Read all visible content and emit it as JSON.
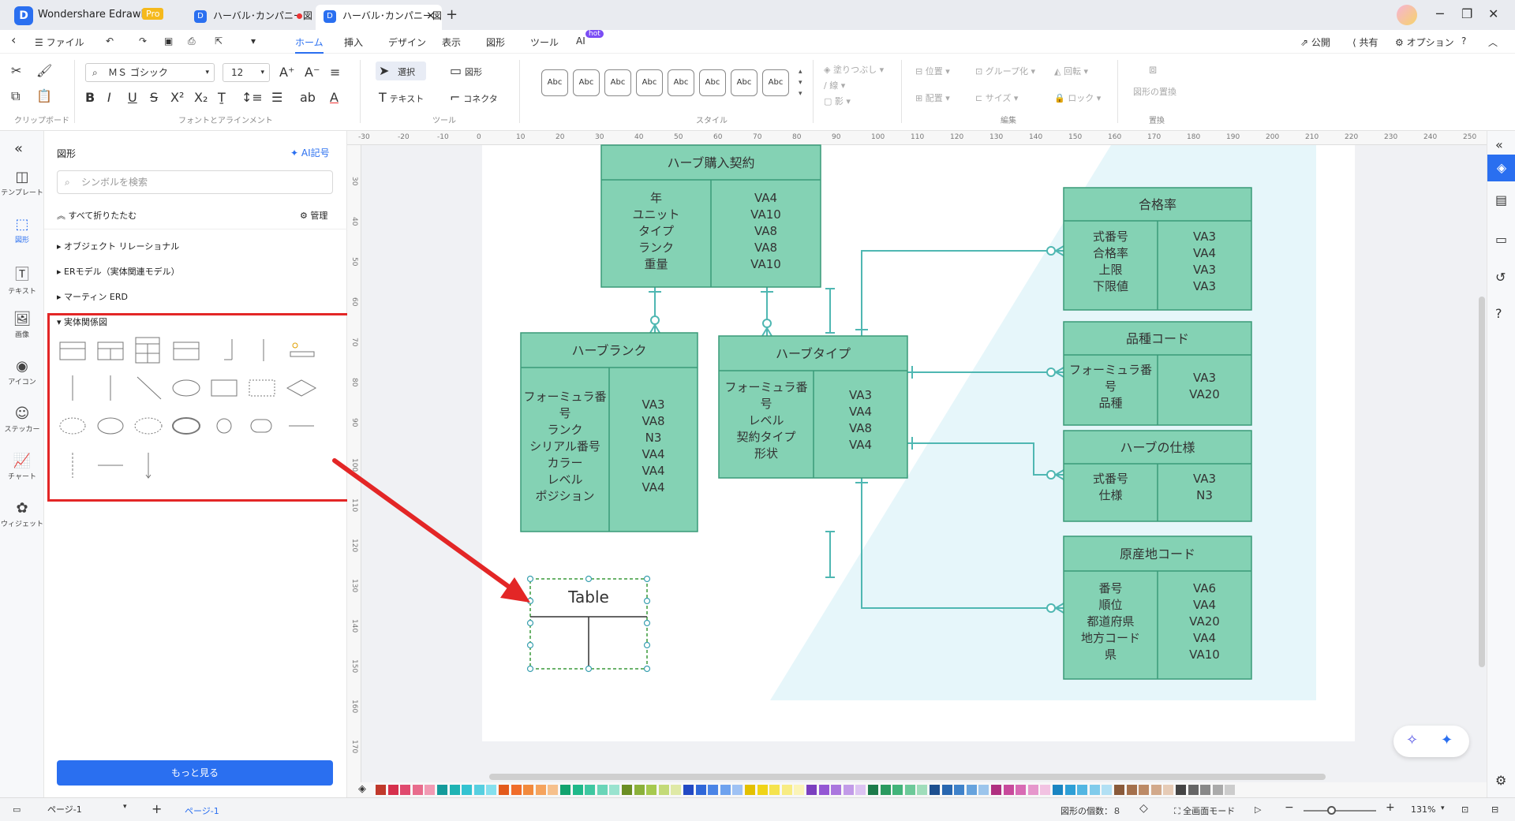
{
  "window": {
    "app_name": "Wondershare EdrawMax",
    "pro_badge": "Pro",
    "tabs": [
      {
        "label": "ハーバル･カンパニー図",
        "unsaved": true
      },
      {
        "label": "ハーバル･カンパニー図",
        "active": true
      }
    ],
    "add_tab": "+"
  },
  "menubar": {
    "file": "ファイル",
    "items": [
      "ホーム",
      "挿入",
      "デザイン",
      "表示",
      "図形",
      "ツール",
      "AI"
    ],
    "ai_badge": "hot",
    "right": {
      "publish": "公開",
      "share": "共有",
      "options": "オプション"
    }
  },
  "ribbon": {
    "clipboard_label": "クリップボード",
    "font_label": "フォントとアラインメント",
    "tool_label": "ツール",
    "style_label": "スタイル",
    "edit_label": "編集",
    "replace_label": "置換",
    "font_family": "ＭＳ ゴシック",
    "font_size": "12",
    "select": "選択",
    "shape": "図形",
    "text": "テキスト",
    "connector": "コネクタ",
    "style_samples": [
      "Abc",
      "Abc",
      "Abc",
      "Abc",
      "Abc",
      "Abc",
      "Abc",
      "Abc"
    ],
    "fill": "塗りつぶし",
    "line": "線",
    "shadow": "影",
    "position": "位置",
    "group": "グループ化",
    "rotate": "回転",
    "align": "配置",
    "size": "サイズ",
    "lock": "ロック",
    "replace_shape": "図形の置換"
  },
  "leftrail": [
    {
      "label": "テンプレート",
      "icon": "template-icon"
    },
    {
      "label": "図形",
      "icon": "shapes-icon",
      "active": true
    },
    {
      "label": "テキスト",
      "icon": "text-icon"
    },
    {
      "label": "画像",
      "icon": "image-icon"
    },
    {
      "label": "アイコン",
      "icon": "icon-icon"
    },
    {
      "label": "ステッカー",
      "icon": "sticker-icon"
    },
    {
      "label": "チャート",
      "icon": "chart-icon"
    },
    {
      "label": "ウィジェット",
      "icon": "widget-icon"
    }
  ],
  "shapepanel": {
    "title": "図形",
    "ai_symbol": "AI記号",
    "search_placeholder": "シンボルを検索",
    "collapse_all": "すべて折りたたむ",
    "manage": "管理",
    "categories": [
      "オブジェクト リレーショナル",
      "ERモデル（実体関連モデル）",
      "マーティン ERD",
      "実体関係図"
    ],
    "more_button": "もっと見る"
  },
  "ruler": {
    "h_ticks": [
      "-30",
      "-20",
      "-10",
      "0",
      "10",
      "20",
      "30",
      "40",
      "50",
      "60",
      "70",
      "80",
      "90",
      "100",
      "110",
      "120",
      "130",
      "140",
      "150",
      "160",
      "170",
      "180",
      "190",
      "200",
      "210",
      "220",
      "230",
      "240",
      "250"
    ],
    "v_ticks": [
      "30",
      "40",
      "50",
      "60",
      "70",
      "80",
      "90",
      "100",
      "110",
      "120",
      "130",
      "140",
      "150",
      "160",
      "170"
    ]
  },
  "diagram": {
    "entities": [
      {
        "id": "herb-purchase",
        "title": "ハーブ購入契約",
        "left": [
          "年",
          "ユニット",
          "タイプ",
          "ランク",
          "重量"
        ],
        "right": [
          "VA4",
          "VA10",
          "VA8",
          "VA8",
          "VA10"
        ]
      },
      {
        "id": "herb-rank",
        "title": "ハーブランク",
        "left": [
          "フォーミュラ番",
          "号",
          "ランク",
          "シリアル番号",
          "カラー",
          "レベル",
          "ポジション"
        ],
        "right": [
          "VA3",
          "VA8",
          "N3",
          "VA4",
          "VA4",
          "VA4"
        ]
      },
      {
        "id": "herb-type",
        "title": "ハーブタイプ",
        "left": [
          "フォーミュラ番",
          "号",
          "レベル",
          "契約タイプ",
          "形状"
        ],
        "right": [
          "VA3",
          "VA4",
          "VA8",
          "VA4"
        ]
      },
      {
        "id": "pass-rate",
        "title": "合格率",
        "left": [
          "式番号",
          "合格率",
          "上限",
          "下限値"
        ],
        "right": [
          "VA3",
          "VA4",
          "VA3",
          "VA3"
        ]
      },
      {
        "id": "variety-code",
        "title": "品種コード",
        "left": [
          "フォーミュラ番",
          "号",
          "品種"
        ],
        "right": [
          "VA3",
          "VA20"
        ]
      },
      {
        "id": "herb-spec",
        "title": "ハーブの仕様",
        "left": [
          "式番号",
          "仕様"
        ],
        "right": [
          "VA3",
          "N3"
        ]
      },
      {
        "id": "origin-code",
        "title": "原産地コード",
        "left": [
          "番号",
          "順位",
          "都道府県",
          "地方コード",
          "県"
        ],
        "right": [
          "VA6",
          "VA4",
          "VA20",
          "VA4",
          "VA10"
        ]
      }
    ],
    "new_table_title": "Table",
    "entity_fill": "#84d2b4",
    "entity_stroke": "#3a9a78",
    "connector_color": "#4fb7b2"
  },
  "colors": [
    "#c0392b",
    "#d6304c",
    "#e04a6e",
    "#e86c8c",
    "#f19ab3",
    "#149b9b",
    "#1fb3b3",
    "#34c3d1",
    "#57cfe0",
    "#86e0ee",
    "#e35a1c",
    "#f06d2b",
    "#f28a3d",
    "#f5a35d",
    "#f6c08c",
    "#12a36e",
    "#1fb98a",
    "#3fc7a1",
    "#6ad5b8",
    "#9ae3cf",
    "#6b8e23",
    "#8bb13a",
    "#a6c94e",
    "#c3da78",
    "#dfe9a6",
    "#2249c4",
    "#2f67d8",
    "#4a84e6",
    "#6ea2ee",
    "#9fc2f4",
    "#e3c000",
    "#f0d418",
    "#f5e34e",
    "#f8ec83",
    "#fbf4b8",
    "#7b3fbf",
    "#9457d4",
    "#aa76de",
    "#c29be8",
    "#dcc3f2",
    "#1c7b4a",
    "#2a9a5f",
    "#42b47a",
    "#6dc999",
    "#a0ddbb",
    "#1d4f8f",
    "#2967b0",
    "#3f82ca",
    "#67a3dd",
    "#9cc5ec",
    "#b03080",
    "#c84a9c",
    "#d86bb4",
    "#e697cc",
    "#f2c2e2",
    "#1a85c2",
    "#2e9fd6",
    "#53b6e2",
    "#80cbeb",
    "#b2e0f4",
    "#8a5a3a",
    "#a4704c",
    "#bc8a66",
    "#d2a98b",
    "#e6cbb6",
    "#444444",
    "#666666",
    "#888888",
    "#aaaaaa",
    "#cccccc"
  ],
  "statusbar": {
    "page_select": "ページ-1",
    "page_tab": "ページ-1",
    "shape_count": "図形の個数：８",
    "fullscreen": "全画面モード",
    "zoom": "131%"
  }
}
